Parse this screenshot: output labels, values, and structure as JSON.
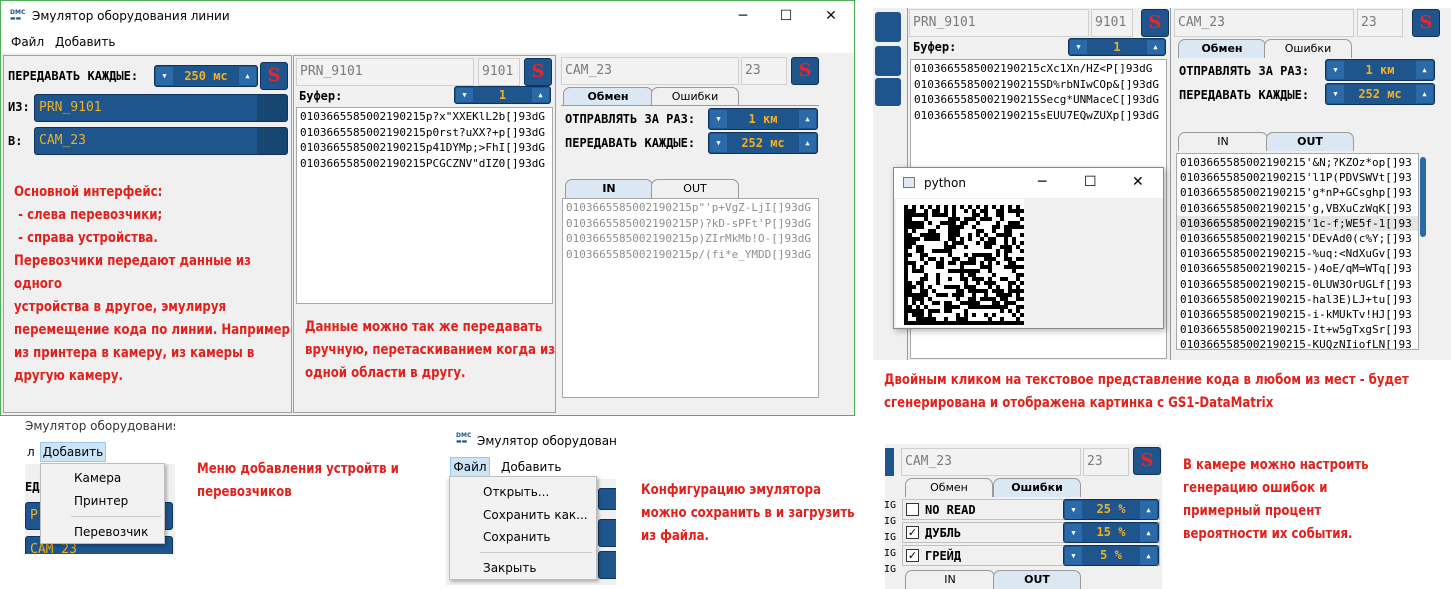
{
  "main_window": {
    "title": "Эмулятор оборудования линии",
    "menu": [
      "Файл",
      "Добавить"
    ],
    "send_every_label": "ПЕРЕДАВАТЬ КАЖДЫЕ:",
    "send_every_value": "250 мс",
    "from_label": "ИЗ:",
    "from_value": "PRN_9101",
    "to_label": "В:",
    "to_value": "CAM_23",
    "printer": {
      "name": "PRN_9101",
      "id": "9101",
      "buffer_label": "Буфер:",
      "buffer_value": "1",
      "codes": [
        "0103665585002190215p?x\"XXEKlL2b[]93dG",
        "0103665585002190215p0rst?uXX?+p[]93dG",
        "0103665585002190215p41DYMp;>FhI[]93dG",
        "0103665585002190215PCGCZNV\"dIZ0[]93dG"
      ]
    },
    "camera": {
      "name": "CAM_23",
      "id": "23",
      "tabs": [
        "Обмен",
        "Ошибки"
      ],
      "send_at_once_label": "ОТПРАВЛЯТЬ ЗА РАЗ:",
      "send_at_once_value": "1 км",
      "send_every_label": "ПЕРЕДАВАТЬ КАЖДЫЕ:",
      "send_every_value": "252 мс",
      "io_tabs": [
        "IN",
        "OUT"
      ],
      "codes": [
        "0103665585002190215p\"'p+VgZ-LjI[]93dG",
        "0103665585002190215P)?kD-sPFt'P[]93dG",
        "0103665585002190215p)ZIrMkMb!O-[]93dG",
        "0103665585002190215p/(fi*e_YMDD[]93dG"
      ]
    },
    "s_label": "S"
  },
  "notes": {
    "main_lines": [
      "Основной интерфейс:",
      " - слева перевозчики;",
      " - справа устройства.",
      "Перевозчики передают данные из одного",
      "устройства в другое, эмулируя",
      "перемещение кода по линии. Например",
      "из принтера в камеру, из камеры в",
      "другую камеру."
    ],
    "drag_lines": [
      "Данные можно так же передавать",
      "вручную, перетаскиванием когда из",
      "одной области в другу."
    ],
    "add_menu_lines": [
      "Меню добавления устройтв и",
      "перевозчиков"
    ],
    "config_lines": [
      "Конфигурацию эмулятора",
      "можно сохранить в и загрузить",
      "из файла."
    ],
    "dblclick_lines": [
      "Двойным кликом на текстовое представление кода в любом из мест - будет",
      "сгенерирована и отображена картинка с GS1-DataMatrix"
    ],
    "camera_errors_lines": [
      "В камере можно настроить",
      "генерацию ошибок и",
      "примерный процент",
      "вероятности их события."
    ]
  },
  "add_menu": {
    "title_fragment": "Эмулятор оборудования ли",
    "file_fragment": "л",
    "menu_label": "Добавить",
    "items": [
      "Камера",
      "Принтер",
      "Перевозчик"
    ],
    "bg_label": "ЕД",
    "bg_bar1": "P",
    "bg_bar2": "CAM_23"
  },
  "file_menu": {
    "title": "Эмулятор оборудования",
    "menu": [
      "Файл",
      "Добавить"
    ],
    "items": [
      "Открыть...",
      "Сохранить как...",
      "Сохранить",
      "Закрыть"
    ]
  },
  "dm_window": {
    "title": "python",
    "bg": {
      "printer_name": "PRN_9101",
      "printer_id": "9101",
      "buffer_label": "Буфер:",
      "buffer_value": "1",
      "printer_codes": [
        "0103665585002190215cXc1Xn/HZ<P[]93dG",
        "0103665585002190215SD%rbNIwCOp&[]93dG",
        "0103665585002190215Secg*UNMaceC[]93dG",
        "0103665585002190215sEUU7EQwZUXp[]93dG"
      ],
      "camera_name": "CAM_23",
      "camera_id": "23",
      "tabs": [
        "Обмен",
        "Ошибки"
      ],
      "send_at_once_label": "ОТПРАВЛЯТЬ ЗА РАЗ:",
      "send_at_once_value": "1 км",
      "send_every_label": "ПЕРЕДАВАТЬ КАЖДЫЕ:",
      "send_every_value": "252 мс",
      "io_tabs": [
        "IN",
        "OUT"
      ],
      "out_codes": [
        "0103665585002190215'&N;?KZOz*op[]93",
        "0103665585002190215'l1P(PDVSWVt[]93",
        "0103665585002190215'g*nP+GCsghp[]93",
        "0103665585002190215'g,VBXuCzWqK[]93",
        "0103665585002190215'1c-f;WE5f-1[]93",
        "0103665585002190215'DEvAd0(c%Y;[]93",
        "0103665585002190215-%uq:<NdXuGv[]93",
        "0103665585002190215-)4oE/qM=WTq[]93",
        "0103665585002190215-0LUW3OrUGLf[]93",
        "0103665585002190215-hal3E)LJ+tu[]93",
        "0103665585002190215-i-kMUkTv!HJ[]93",
        "0103665585002190215-It+w5gTxgSr[]93",
        "0103665585002190215-KUQzNIiofLN[]93"
      ]
    }
  },
  "errors_panel": {
    "camera_name": "CAM_23",
    "camera_id": "23",
    "tabs": [
      "Обмен",
      "Ошибки"
    ],
    "rows": [
      {
        "label": "NO READ",
        "value": "25 %",
        "checked": false
      },
      {
        "label": "ДУБЛЬ",
        "value": "15 %",
        "checked": true
      },
      {
        "label": "ГРЕЙД",
        "value": "5 %",
        "checked": true
      }
    ],
    "io_tabs": [
      "IN",
      "OUT"
    ],
    "side_letters": [
      "IG",
      "IG",
      "IG",
      "IG",
      "IG"
    ]
  }
}
